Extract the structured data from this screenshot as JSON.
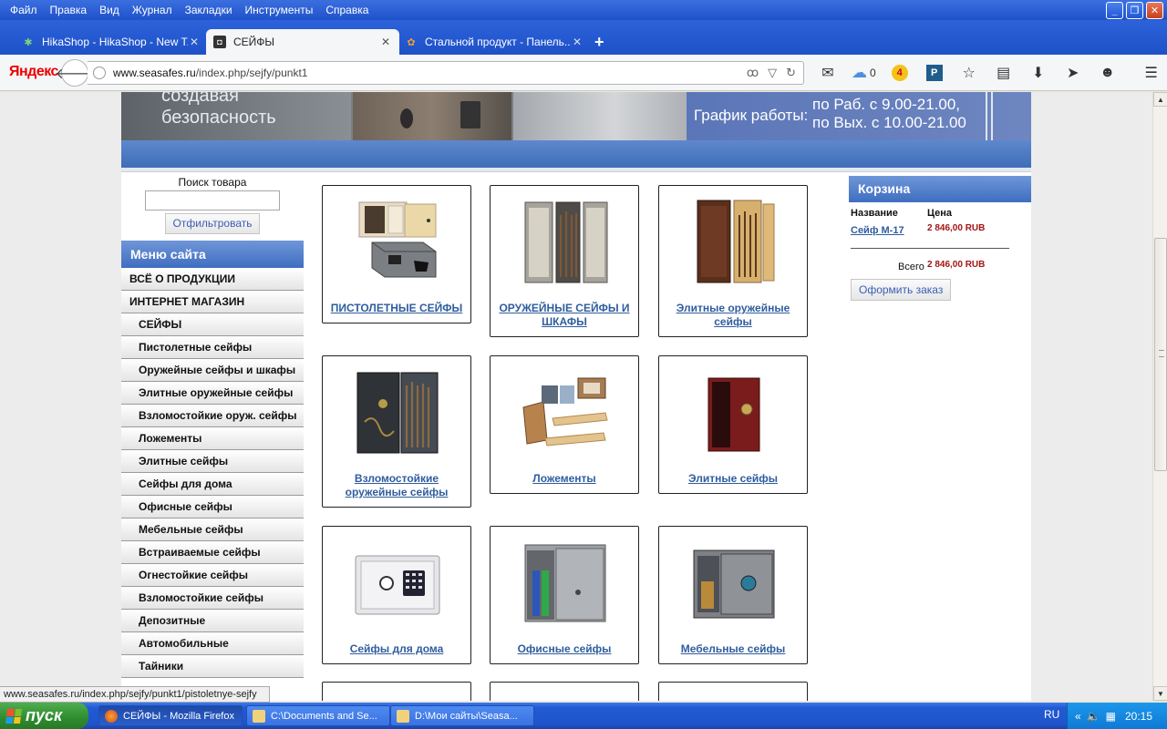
{
  "menubar": {
    "items": [
      "Файл",
      "Правка",
      "Вид",
      "Журнал",
      "Закладки",
      "Инструменты",
      "Справка"
    ]
  },
  "tabs": [
    {
      "label": "HikaShop - HikaShop - New T...",
      "icon": "hikashop-icon",
      "active": false
    },
    {
      "label": "СЕЙФЫ",
      "icon": "site-icon",
      "active": true
    },
    {
      "label": "Стальной продукт - Панель...",
      "icon": "joomla-icon",
      "active": false
    }
  ],
  "navbar": {
    "brand": "Яндекс",
    "url_host": "www.seasafes.ru",
    "url_path": "/index.php/sejfy/punkt1",
    "cloud_count": "0",
    "badge": "4",
    "badge_p": "P"
  },
  "banner": {
    "slogan_line1": "создавая",
    "slogan_line2": "безопасность",
    "schedule_label": "График работы:",
    "schedule_weekday": "по Раб. с 9.00-21.00,",
    "schedule_weekend": "по Вых. с 10.00-21.00"
  },
  "search": {
    "label": "Поиск товара",
    "value": "",
    "button": "Отфильтровать"
  },
  "menu": {
    "title": "Меню сайта",
    "items": [
      {
        "label": "ВСЁ О ПРОДУКЦИИ",
        "sub": false
      },
      {
        "label": "ИНТЕРНЕТ МАГАЗИН",
        "sub": false
      },
      {
        "label": "СЕЙФЫ",
        "sub": true
      },
      {
        "label": "Пистолетные сейфы",
        "sub": true
      },
      {
        "label": "Оружейные сейфы и шкафы",
        "sub": true
      },
      {
        "label": "Элитные оружейные сейфы",
        "sub": true
      },
      {
        "label": "Взломостойкие оруж. сейфы",
        "sub": true
      },
      {
        "label": "Ложементы",
        "sub": true
      },
      {
        "label": "Элитные сейфы",
        "sub": true
      },
      {
        "label": "Сейфы для дома",
        "sub": true
      },
      {
        "label": "Офисные сейфы",
        "sub": true
      },
      {
        "label": "Мебельные сейфы",
        "sub": true
      },
      {
        "label": "Встраиваемые сейфы",
        "sub": true
      },
      {
        "label": "Огнестойкие сейфы",
        "sub": true
      },
      {
        "label": "Взломостойкие сейфы",
        "sub": true
      },
      {
        "label": "Депозитные",
        "sub": true
      },
      {
        "label": "Автомобильные",
        "sub": true
      },
      {
        "label": "Тайники",
        "sub": true
      }
    ]
  },
  "products": [
    {
      "title": "ПИСТОЛЕТНЫЕ СЕЙФЫ",
      "img": "pistol-safe"
    },
    {
      "title": "ОРУЖЕЙНЫЕ СЕЙФЫ И ШКАФЫ",
      "img": "gun-cabinet"
    },
    {
      "title": "Элитные оружейные сейфы",
      "img": "elite-gun-cabinet"
    },
    {
      "title": "Взломостойкие оружейные сейфы",
      "img": "burglary-gun-safe"
    },
    {
      "title": "Ложементы",
      "img": "gun-racks"
    },
    {
      "title": "Элитные сейфы",
      "img": "elite-safe"
    },
    {
      "title": "Сейфы для дома",
      "img": "home-safe"
    },
    {
      "title": "Офисные сейфы",
      "img": "office-safe"
    },
    {
      "title": "Мебельные сейфы",
      "img": "furniture-safe"
    }
  ],
  "cart": {
    "title": "Корзина",
    "col_name": "Название",
    "col_price": "Цена",
    "item_name": "Сейф М-17",
    "item_price": "2 846,00 RUB",
    "total_label": "Всего",
    "total_value": "2 846,00 RUB",
    "order_button": "Оформить заказ"
  },
  "status_url": "www.seasafes.ru/index.php/sejfy/punkt1/pistoletnye-sejfy",
  "taskbar": {
    "start": "пуск",
    "tasks": [
      {
        "label": "СЕЙФЫ - Mozilla Firefox",
        "active": true
      },
      {
        "label": "C:\\Documents and Se...",
        "active": false
      },
      {
        "label": "D:\\Мои сайты\\Seasa...",
        "active": false
      }
    ],
    "lang": "RU",
    "clock": "20:15"
  },
  "colors": {
    "accent_blue": "#3f6ec0",
    "link": "#2f5d9e",
    "price_red": "#a31414"
  }
}
